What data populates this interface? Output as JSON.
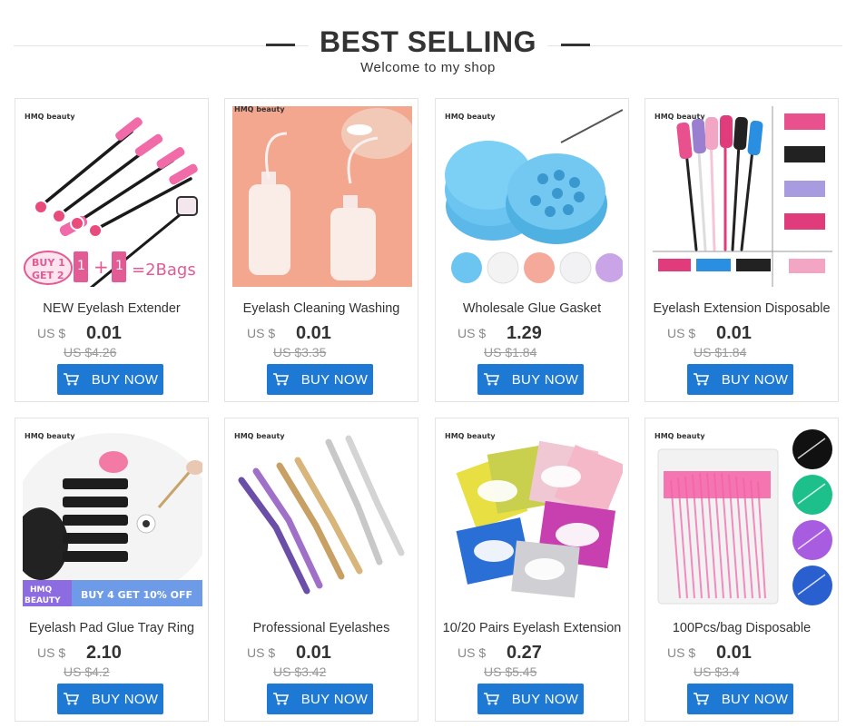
{
  "header": {
    "title": "BEST SELLING",
    "subtitle": "Welcome to my shop"
  },
  "buy_label": "BUY NOW",
  "brand_label": "HMQ beauty",
  "products": [
    {
      "name": "NEW Eyelash Extender",
      "currency": "US $",
      "price": "0.01",
      "old_price": "US $4.26",
      "promo": "BUY 1 GET 2 = 2Bags"
    },
    {
      "name": "Eyelash Cleaning Washing",
      "currency": "US $",
      "price": "0.01",
      "old_price": "US $3.35"
    },
    {
      "name": "Wholesale Glue Gasket",
      "currency": "US $",
      "price": "1.29",
      "old_price": "US $1.84"
    },
    {
      "name": "Eyelash Extension Disposable",
      "currency": "US $",
      "price": "0.01",
      "old_price": "US $1.84"
    },
    {
      "name": "Eyelash Pad Glue Tray Ring",
      "currency": "US $",
      "price": "2.10",
      "old_price": "US $4.2",
      "promo": "HMQ BEAUTY  BUY 4 GET 10% OFF"
    },
    {
      "name": "Professional Eyelashes",
      "currency": "US $",
      "price": "0.01",
      "old_price": "US $3.42"
    },
    {
      "name": "10/20 Pairs Eyelash Extension",
      "currency": "US $",
      "price": "0.27",
      "old_price": "US $5.45"
    },
    {
      "name": "100Pcs/bag Disposable",
      "currency": "US $",
      "price": "0.01",
      "old_price": "US $3.4"
    }
  ],
  "colors": {
    "button": "#1d79d4",
    "title": "#333333"
  }
}
